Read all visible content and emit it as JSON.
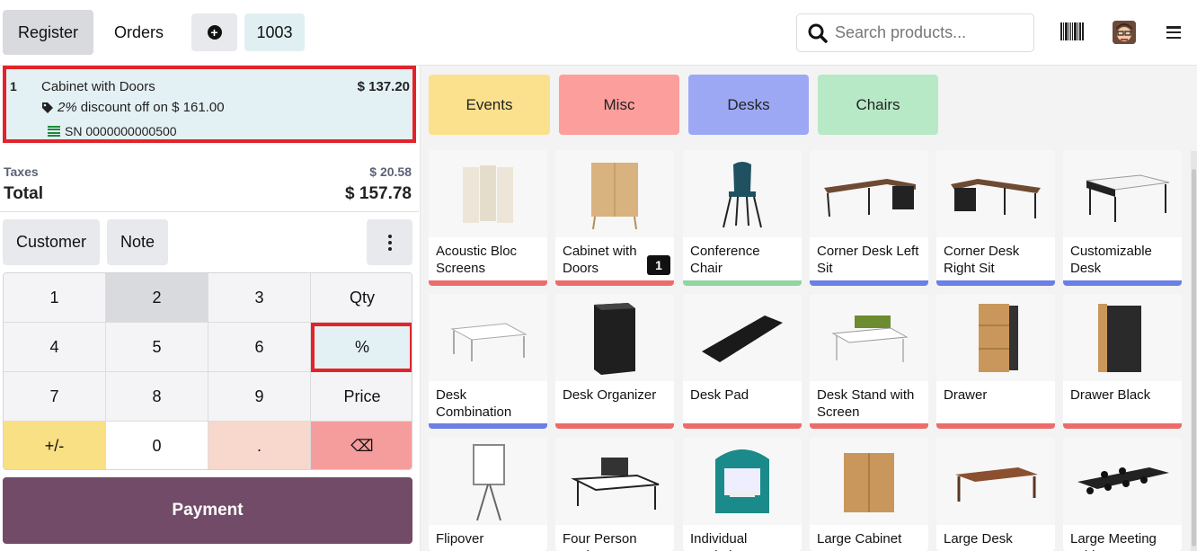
{
  "header": {
    "register_label": "Register",
    "orders_label": "Orders",
    "order_number": "1003",
    "search_placeholder": "Search products..."
  },
  "order": {
    "lines": [
      {
        "qty": "1",
        "name": "Cabinet with Doors",
        "price": "$ 137.20",
        "discount_pct": "2%",
        "discount_text": "discount off on $ 161.00",
        "serial": "SN 0000000000500"
      }
    ],
    "taxes_label": "Taxes",
    "taxes_value": "$ 20.58",
    "total_label": "Total",
    "total_value": "$ 157.78"
  },
  "actions": {
    "customer_label": "Customer",
    "note_label": "Note"
  },
  "numpad": {
    "keys": [
      "1",
      "2",
      "3",
      "Qty",
      "4",
      "5",
      "6",
      "%",
      "7",
      "8",
      "9",
      "Price",
      "+/-",
      "0",
      ".",
      "⌫"
    ],
    "active_key": "2",
    "selected_mode": "%"
  },
  "payment_label": "Payment",
  "categories": [
    {
      "label": "Events",
      "color": "#fbe18e"
    },
    {
      "label": "Misc",
      "color": "#fc9e9c"
    },
    {
      "label": "Desks",
      "color": "#9da8f5"
    },
    {
      "label": "Chairs",
      "color": "#b8e9c6"
    }
  ],
  "products": [
    {
      "name": "Acoustic Bloc Screens",
      "bar": "#ed6c6b"
    },
    {
      "name": "Cabinet with Doors",
      "bar": "#ed6c6b",
      "badge": "1"
    },
    {
      "name": "Conference Chair",
      "bar": "#8fd6a0"
    },
    {
      "name": "Corner Desk Left Sit",
      "bar": "#6b7fe6"
    },
    {
      "name": "Corner Desk Right Sit",
      "bar": "#6b7fe6"
    },
    {
      "name": "Customizable Desk",
      "bar": "#6b7fe6"
    },
    {
      "name": "Desk Combination",
      "bar": "#6b7fe6"
    },
    {
      "name": "Desk Organizer",
      "bar": "#ed6c6b"
    },
    {
      "name": "Desk Pad",
      "bar": "#ed6c6b"
    },
    {
      "name": "Desk Stand with Screen",
      "bar": "#ed6c6b"
    },
    {
      "name": "Drawer",
      "bar": "#ed6c6b"
    },
    {
      "name": "Drawer Black",
      "bar": "#ed6c6b"
    },
    {
      "name": "Flipover",
      "bar": ""
    },
    {
      "name": "Four Person Desk",
      "bar": ""
    },
    {
      "name": "Individual Workplace",
      "bar": ""
    },
    {
      "name": "Large Cabinet",
      "bar": ""
    },
    {
      "name": "Large Desk",
      "bar": ""
    },
    {
      "name": "Large Meeting Table",
      "bar": ""
    }
  ]
}
